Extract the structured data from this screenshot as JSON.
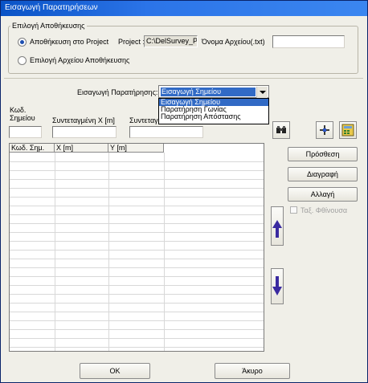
{
  "window": {
    "title": "Εισαγωγή Παρατηρήσεων"
  },
  "storage_group": {
    "legend": "Επιλογή Αποθήκευσης",
    "radio_project": "Αποθήκευση στο Project",
    "radio_file": "Επιλογή Αρχείου Αποθήκευσης",
    "project_label": "Project :",
    "project_value": "C:\\DelSurvey_Pr",
    "filename_label": "Όνομα Αρχείου(.txt)",
    "filename_value": ""
  },
  "observation": {
    "label": "Εισαγωγή Παρατήρησης:",
    "selected": "Εισαγωγή Σημείου",
    "options": [
      "Εισαγωγή Σημείου",
      "Παρατήρηση Γωνίας",
      "Παρατήρηση Απόστασης"
    ]
  },
  "fields": {
    "code_label": "Κωδ. Σημείου",
    "x_label": "Συντεταγμένη X [m]",
    "y_label": "Συντεταγ",
    "code_value": "",
    "x_value": "",
    "y_value": ""
  },
  "grid": {
    "columns": [
      "Κωδ. Σημ.",
      "X [m]",
      "Y [m]"
    ]
  },
  "buttons": {
    "add": "Πρόσθεση",
    "delete": "Διαγραφή",
    "change": "Αλλαγή",
    "ok": "OK",
    "cancel": "Άκυρο"
  },
  "sort_desc_label": "Ταξ. Φθίνουσα",
  "icons": [
    "binoculars-icon",
    "crosshair-icon",
    "calculator-icon",
    "arrow-up-icon",
    "arrow-down-icon"
  ],
  "colors": {
    "title_bar": "#0a53c6",
    "selection": "#316ac5",
    "arrow": "#3a2aa0"
  }
}
